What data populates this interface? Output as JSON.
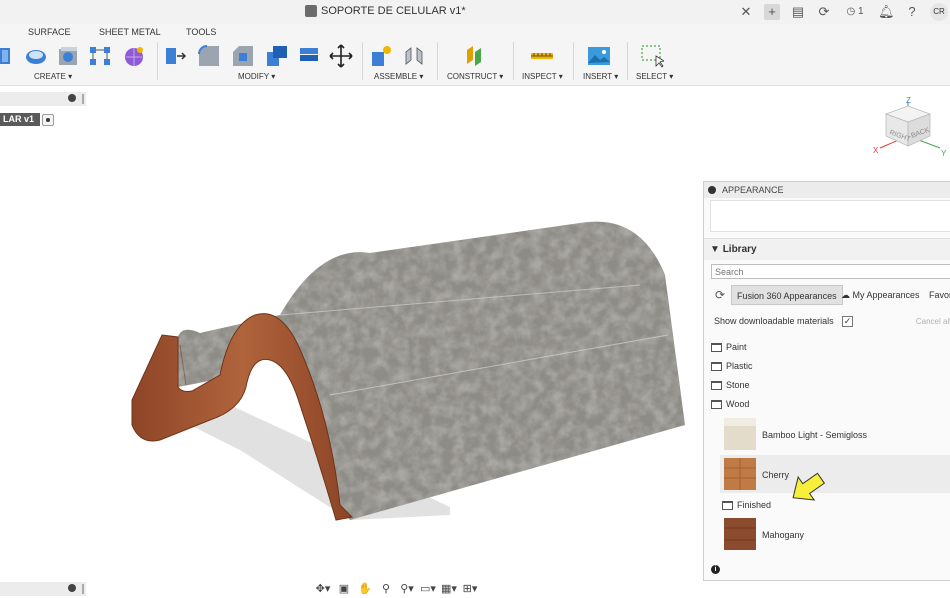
{
  "titlebar": {
    "document_title": "SOPORTE DE CELULAR v1*",
    "jobs_count": "1",
    "user_initials": "CR"
  },
  "toolbar": {
    "tabs": [
      "SURFACE",
      "SHEET METAL",
      "TOOLS"
    ],
    "groups": {
      "create": "CREATE ▾",
      "modify": "MODIFY ▾",
      "assemble": "ASSEMBLE ▾",
      "construct": "CONSTRUCT ▾",
      "inspect": "INSPECT ▾",
      "insert": "INSERT ▾",
      "select": "SELECT ▾"
    }
  },
  "browser": {
    "root_label": "LAR v1"
  },
  "viewcube": {
    "right": "RIGHT",
    "back": "BACK",
    "axis_x": "X",
    "axis_y": "Y",
    "axis_z": "Z"
  },
  "appearance_panel": {
    "title": "APPEARANCE",
    "library_heading": "Library",
    "search_placeholder": "Search",
    "tabs": [
      "Fusion 360 Appearances",
      "My Appearances",
      "Favori"
    ],
    "show_downloadable": "Show downloadable materials",
    "show_downloadable_checked": true,
    "cancel_all": "Cancel all",
    "folders": [
      "Paint",
      "Plastic",
      "Stone",
      "Wood"
    ],
    "wood_items": [
      {
        "name": "Bamboo Light - Semigloss",
        "color": "#e4dccb"
      },
      {
        "name": "Cherry",
        "color": "#c07a45"
      },
      {
        "subfolder": "Finished"
      },
      {
        "name": "Mahogany",
        "color": "#8a4b2f"
      }
    ]
  },
  "colors": {
    "accent_grey": "#5a5a5a",
    "wood_profile": "#a85a3a",
    "stone": "#8e8c86"
  }
}
